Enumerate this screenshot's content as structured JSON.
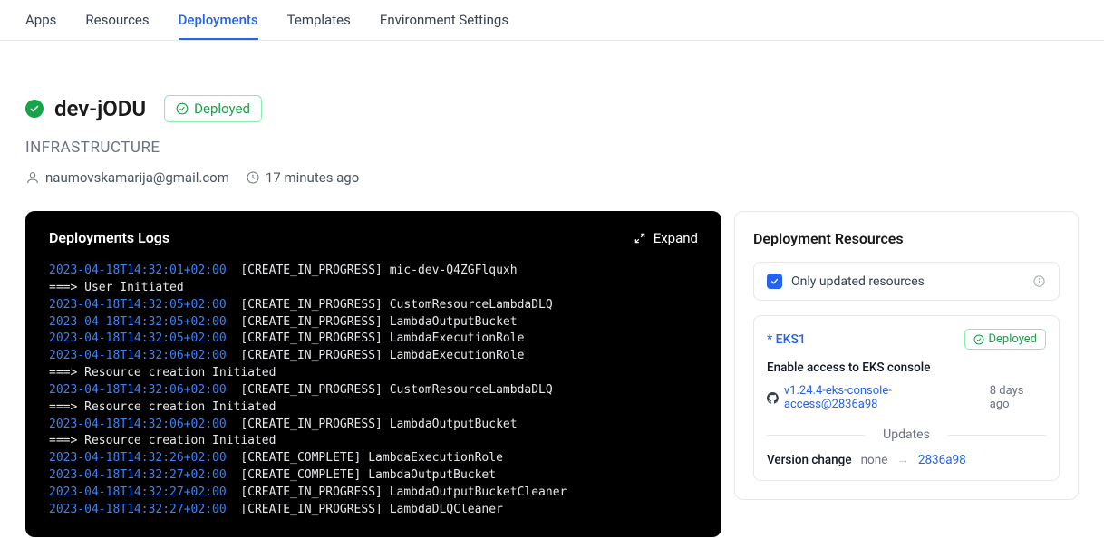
{
  "nav": {
    "items": [
      "Apps",
      "Resources",
      "Deployments",
      "Templates",
      "Environment Settings"
    ],
    "active_index": 2
  },
  "header": {
    "name": "dev-jODU",
    "status_badge": "Deployed",
    "category": "INFRASTRUCTURE",
    "user": "naumovskamarija@gmail.com",
    "time": "17 minutes ago"
  },
  "logs": {
    "title": "Deployments Logs",
    "expand_label": "Expand",
    "entries": [
      {
        "ts": "2023-04-18T14:32:01+02:00",
        "msg": "[CREATE_IN_PROGRESS] mic-dev-Q4ZGFlquxh",
        "sub": "===> User Initiated"
      },
      {
        "ts": "2023-04-18T14:32:05+02:00",
        "msg": "[CREATE_IN_PROGRESS] CustomResourceLambdaDLQ"
      },
      {
        "ts": "2023-04-18T14:32:05+02:00",
        "msg": "[CREATE_IN_PROGRESS] LambdaOutputBucket"
      },
      {
        "ts": "2023-04-18T14:32:05+02:00",
        "msg": "[CREATE_IN_PROGRESS] LambdaExecutionRole"
      },
      {
        "ts": "2023-04-18T14:32:06+02:00",
        "msg": "[CREATE_IN_PROGRESS] LambdaExecutionRole",
        "sub": "===> Resource creation Initiated"
      },
      {
        "ts": "2023-04-18T14:32:06+02:00",
        "msg": "[CREATE_IN_PROGRESS] CustomResourceLambdaDLQ",
        "sub": "===> Resource creation Initiated"
      },
      {
        "ts": "2023-04-18T14:32:06+02:00",
        "msg": "[CREATE_IN_PROGRESS] LambdaOutputBucket",
        "sub": "===> Resource creation Initiated"
      },
      {
        "ts": "2023-04-18T14:32:26+02:00",
        "msg": "[CREATE_COMPLETE] LambdaExecutionRole"
      },
      {
        "ts": "2023-04-18T14:32:27+02:00",
        "msg": "[CREATE_COMPLETE] LambdaOutputBucket"
      },
      {
        "ts": "2023-04-18T14:32:27+02:00",
        "msg": "[CREATE_IN_PROGRESS] LambdaOutputBucketCleaner"
      },
      {
        "ts": "2023-04-18T14:32:27+02:00",
        "msg": "[CREATE_IN_PROGRESS] LambdaDLQCleaner"
      }
    ]
  },
  "resources": {
    "title": "Deployment Resources",
    "filter_label": "Only updated resources",
    "card": {
      "name": "* EKS1",
      "badge": "Deployed",
      "desc": "Enable access to EKS console",
      "version": "v1.24.4-eks-console-access@2836a98",
      "time": "8 days ago",
      "updates_label": "Updates",
      "version_change_label": "Version change",
      "version_from": "none",
      "version_to": "2836a98"
    }
  }
}
